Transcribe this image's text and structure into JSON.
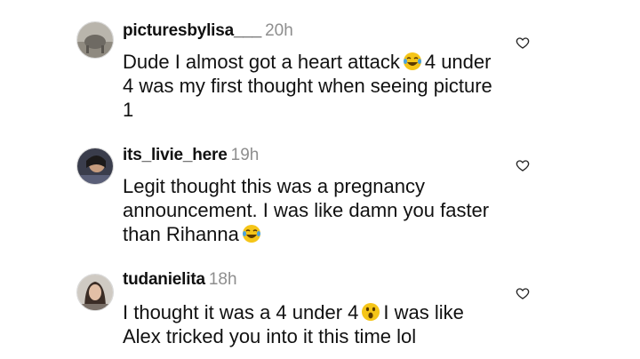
{
  "comments": [
    {
      "username": "picturesbylisa___",
      "time": "20h",
      "text_before": "Dude I almost got a heart attack",
      "emoji": "tears-of-joy-emoji",
      "text_after": "4 under 4 was my first thought when seeing picture 1"
    },
    {
      "username": "its_livie_here",
      "time": "19h",
      "text_before": "Legit thought this was a pregnancy announcement. I was like damn you faster than Rihanna",
      "emoji": "tears-of-joy-emoji",
      "text_after": ""
    },
    {
      "username": "tudanielita",
      "time": "18h",
      "text_before": "I thought it was a 4 under 4",
      "emoji": "astonished-face-emoji",
      "text_after": "I was like Alex tricked you into it this time lol"
    }
  ],
  "icons": {
    "like": "heart-outline-icon"
  },
  "colors": {
    "text": "#111111",
    "timestamp": "#8e8e8e",
    "emoji": "#f5c518"
  }
}
